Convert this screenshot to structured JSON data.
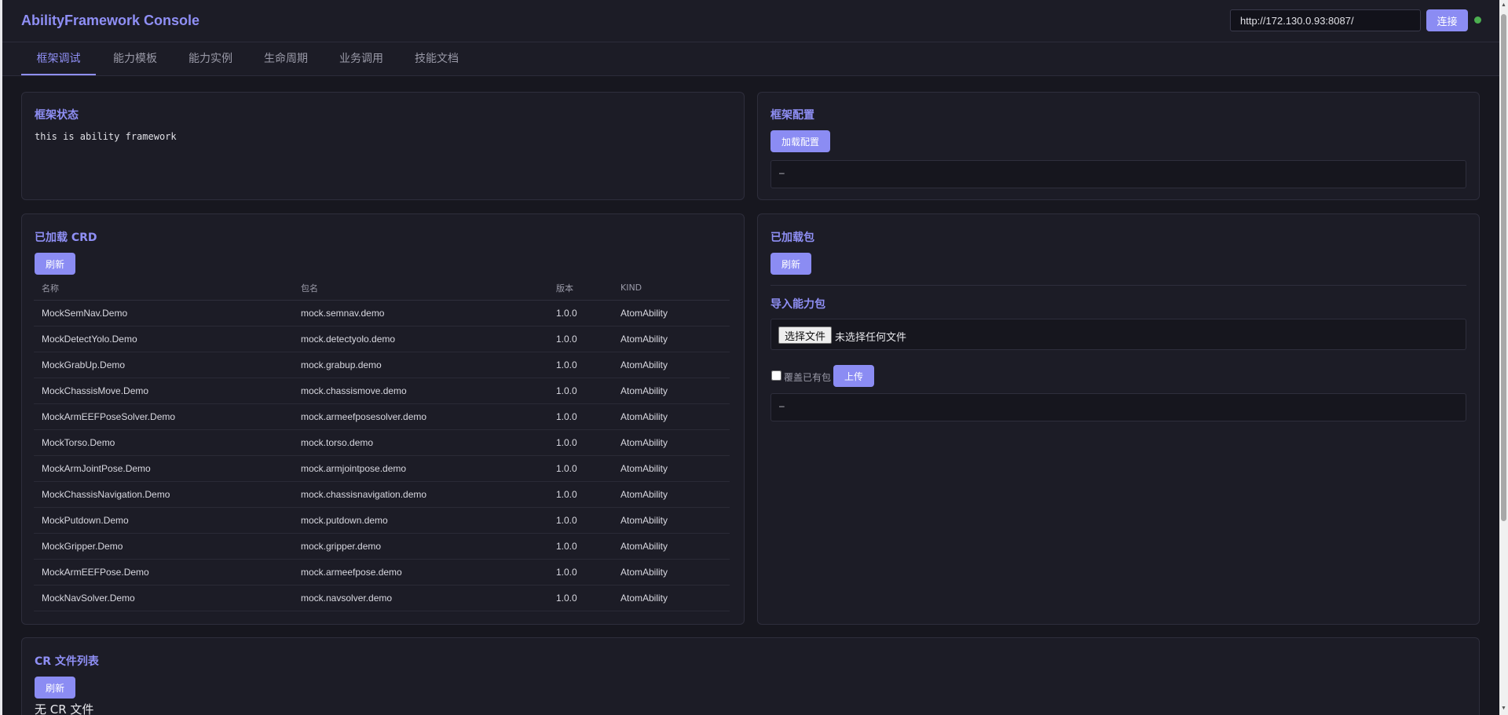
{
  "header": {
    "title": "AbilityFramework Console",
    "url_value": "http://172.130.0.93:8087/",
    "connect_label": "连接",
    "status_color": "#4caf50"
  },
  "tabs": [
    {
      "label": "框架调试",
      "active": true
    },
    {
      "label": "能力模板",
      "active": false
    },
    {
      "label": "能力实例",
      "active": false
    },
    {
      "label": "生命周期",
      "active": false
    },
    {
      "label": "业务调用",
      "active": false
    },
    {
      "label": "技能文档",
      "active": false
    }
  ],
  "framework_status": {
    "title": "框架状态",
    "text": "this is ability framework"
  },
  "framework_config": {
    "title": "框架配置",
    "load_label": "加载配置",
    "output": "–"
  },
  "loaded_crd": {
    "title": "已加载 CRD",
    "refresh_label": "刷新",
    "columns": [
      "名称",
      "包名",
      "版本",
      "KIND"
    ],
    "rows": [
      [
        "MockSemNav.Demo",
        "mock.semnav.demo",
        "1.0.0",
        "AtomAbility"
      ],
      [
        "MockDetectYolo.Demo",
        "mock.detectyolo.demo",
        "1.0.0",
        "AtomAbility"
      ],
      [
        "MockGrabUp.Demo",
        "mock.grabup.demo",
        "1.0.0",
        "AtomAbility"
      ],
      [
        "MockChassisMove.Demo",
        "mock.chassismove.demo",
        "1.0.0",
        "AtomAbility"
      ],
      [
        "MockArmEEFPoseSolver.Demo",
        "mock.armeefposesolver.demo",
        "1.0.0",
        "AtomAbility"
      ],
      [
        "MockTorso.Demo",
        "mock.torso.demo",
        "1.0.0",
        "AtomAbility"
      ],
      [
        "MockArmJointPose.Demo",
        "mock.armjointpose.demo",
        "1.0.0",
        "AtomAbility"
      ],
      [
        "MockChassisNavigation.Demo",
        "mock.chassisnavigation.demo",
        "1.0.0",
        "AtomAbility"
      ],
      [
        "MockPutdown.Demo",
        "mock.putdown.demo",
        "1.0.0",
        "AtomAbility"
      ],
      [
        "MockGripper.Demo",
        "mock.gripper.demo",
        "1.0.0",
        "AtomAbility"
      ],
      [
        "MockArmEEFPose.Demo",
        "mock.armeefpose.demo",
        "1.0.0",
        "AtomAbility"
      ],
      [
        "MockNavSolver.Demo",
        "mock.navsolver.demo",
        "1.0.0",
        "AtomAbility"
      ]
    ]
  },
  "loaded_packages": {
    "title": "已加载包",
    "refresh_label": "刷新",
    "import_title": "导入能力包",
    "choose_file_label": "选择文件",
    "no_file_label": "未选择任何文件",
    "overwrite_label": "覆盖已有包",
    "upload_label": "上传",
    "output": "–"
  },
  "cr_files": {
    "title": "CR 文件列表",
    "refresh_label": "刷新",
    "empty_text": "无 CR 文件"
  },
  "colors": {
    "accent": "#8b8cf3",
    "background": "#17171f",
    "card": "#1c1c26"
  }
}
